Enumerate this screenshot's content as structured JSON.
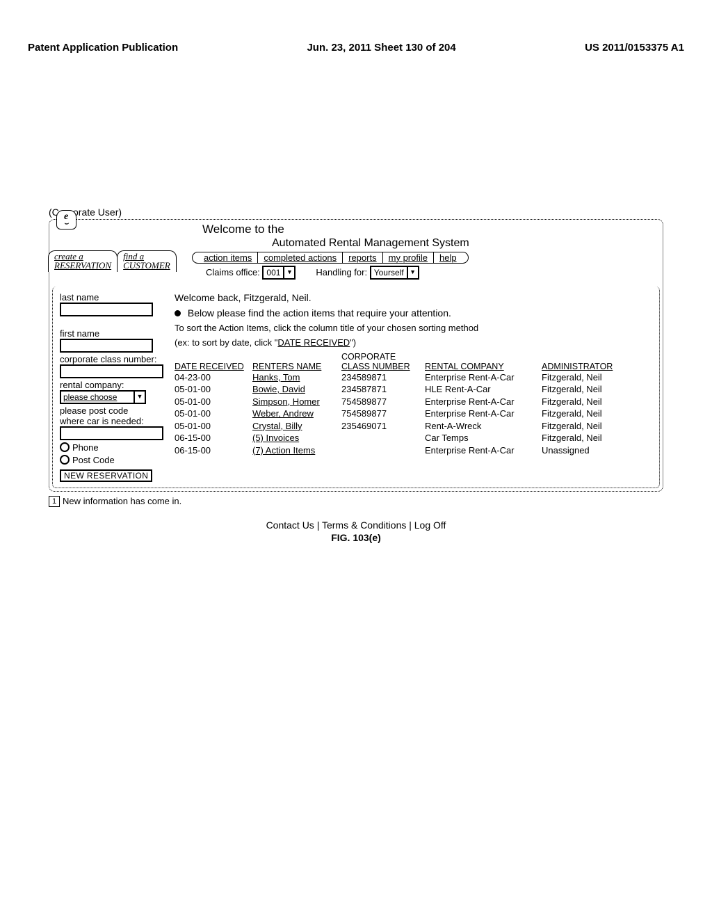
{
  "header": {
    "left": "Patent Application Publication",
    "center": "Jun. 23, 2011  Sheet 130 of 204",
    "right": "US 2011/0153375 A1"
  },
  "user_label": "(Corporate User)",
  "logo_letter": "e",
  "welcome": {
    "line1": "Welcome to the",
    "line2": "Automated Rental Management System"
  },
  "folder_tabs": {
    "create_line1": "create a",
    "create_line2": "RESERVATION",
    "find_line1": "find a",
    "find_line2": "CUSTOMER"
  },
  "nav": {
    "action_items": "action items",
    "completed_actions": "completed actions",
    "reports": "reports",
    "my_profile": "my profile",
    "help": "help"
  },
  "controls": {
    "claims_label": "Claims office:",
    "claims_value": "001",
    "handling_label": "Handling for:",
    "handling_value": "Yourself"
  },
  "sidebar": {
    "last_name": "last name",
    "first_name": "first name",
    "ccn": "corporate class number:",
    "rental_company": "rental company:",
    "please_choose": "please choose",
    "post_code_line1": "please post code",
    "post_code_line2": "where car is needed:",
    "phone": "Phone",
    "post_code": "Post Code",
    "new_reservation": "NEW RESERVATION"
  },
  "main": {
    "welcome_back": "Welcome back, Fitzgerald, Neil.",
    "attention": "Below please find the action items that require your attention.",
    "sort_note_1": "To sort the Action Items, click the column title of your chosen sorting method",
    "sort_note_2a": "(ex: to sort by date, click \"",
    "sort_note_2b": "DATE RECEIVED",
    "sort_note_2c": "\")",
    "col_corporate_pre": "CORPORATE",
    "columns": {
      "date": "DATE RECEIVED",
      "renter": "RENTERS NAME",
      "class": "CLASS NUMBER",
      "company": "RENTAL COMPANY",
      "admin": "ADMINISTRATOR"
    },
    "rows": [
      {
        "date": "04-23-00",
        "renter": "Hanks, Tom",
        "link": true,
        "class": "234589871",
        "company": "Enterprise Rent-A-Car",
        "admin": "Fitzgerald, Neil"
      },
      {
        "date": "05-01-00",
        "renter": "Bowie, David",
        "link": true,
        "class": "234587871",
        "company": "HLE Rent-A-Car",
        "admin": "Fitzgerald, Neil"
      },
      {
        "date": "05-01-00",
        "renter": "Simpson, Homer",
        "link": true,
        "class": "754589877",
        "company": "Enterprise Rent-A-Car",
        "admin": "Fitzgerald, Neil"
      },
      {
        "date": "05-01-00",
        "renter": "Weber, Andrew",
        "link": true,
        "class": "754589877",
        "company": "Enterprise Rent-A-Car",
        "admin": "Fitzgerald, Neil"
      },
      {
        "date": "05-01-00",
        "renter": "Crystal, Billy",
        "link": true,
        "class": "235469071",
        "company": "Rent-A-Wreck",
        "admin": "Fitzgerald, Neil"
      },
      {
        "date": "06-15-00",
        "renter": "(5) Invoices",
        "link": true,
        "class": "",
        "company": "Car Temps",
        "admin": "Fitzgerald, Neil"
      },
      {
        "date": "06-15-00",
        "renter": "(7) Action Items",
        "link": true,
        "class": "",
        "company": "Enterprise Rent-A-Car",
        "admin": "Unassigned"
      }
    ]
  },
  "footnote_num": "1",
  "footnote": "New information has come in.",
  "bottom_links": "Contact Us | Terms & Conditions | Log Off",
  "figure": "FIG. 103(e)"
}
